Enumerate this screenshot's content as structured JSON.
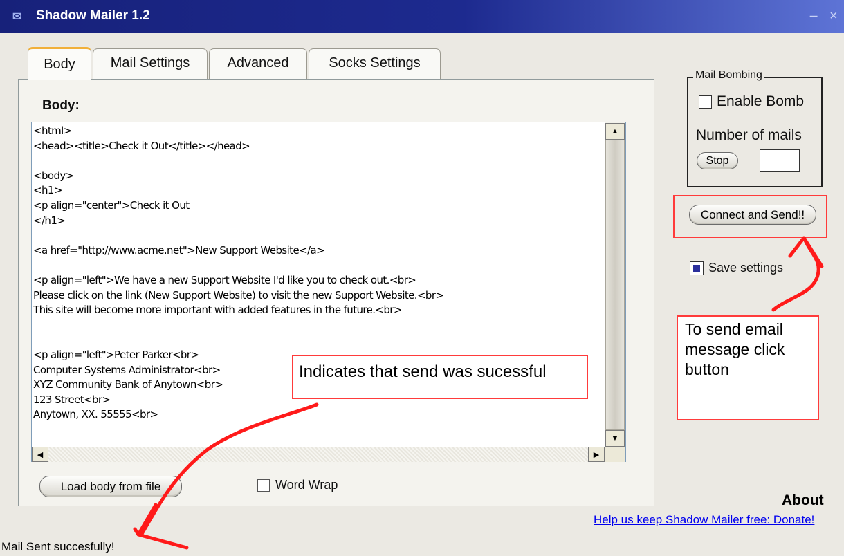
{
  "window": {
    "icon": "envelope-icon",
    "title": "Shadow Mailer 1.2",
    "minimize_glyph": "–",
    "close_glyph": "×"
  },
  "tabs": [
    {
      "label": "Body",
      "selected": true
    },
    {
      "label": "Mail Settings",
      "selected": false
    },
    {
      "label": "Advanced",
      "selected": false
    },
    {
      "label": "Socks Settings",
      "selected": false
    }
  ],
  "body_panel": {
    "label": "Body:",
    "editor_text": "<html>\n<head><title>Check it Out</title></head>\n\n<body>\n<h1>\n<p align=\"center\">Check it Out\n</h1>\n\n<a href=\"http://www.acme.net\">New Support Website</a>\n\n<p align=\"left\">We have a new Support Website I'd like you to check out.<br>\nPlease click on the link (New Support Website) to visit the new Support Website.<br>\nThis site will become more important with added features in the future.<br>\n\n\n<p align=\"left\">Peter Parker<br>\nComputer Systems Administrator<br>\nXYZ Community Bank of Anytown<br>\n123 Street<br>\nAnytown, XX. 55555<br>",
    "load_button": "Load body from file",
    "word_wrap_label": "Word Wrap",
    "word_wrap_checked": false
  },
  "mail_bombing": {
    "legend": "Mail Bombing",
    "enable_label": "Enable Bomb",
    "enable_checked": false,
    "number_label": "Number of mails",
    "stop_button": "Stop",
    "number_value": ""
  },
  "connect_button": "Connect and Send!!",
  "save_settings": {
    "label": "Save settings",
    "checked": true
  },
  "about_label": "About",
  "donate_link": "Help us keep Shadow Mailer free: Donate!",
  "status_text": "Mail Sent succesfully!",
  "annotations": {
    "sent_note": "Indicates that send was sucessful",
    "send_note": "To send email message click button",
    "color": "#ff0000"
  },
  "colors": {
    "titlebar": "#1d2a8f",
    "accent_tab": "#f1b03a",
    "link": "#0000ee"
  }
}
